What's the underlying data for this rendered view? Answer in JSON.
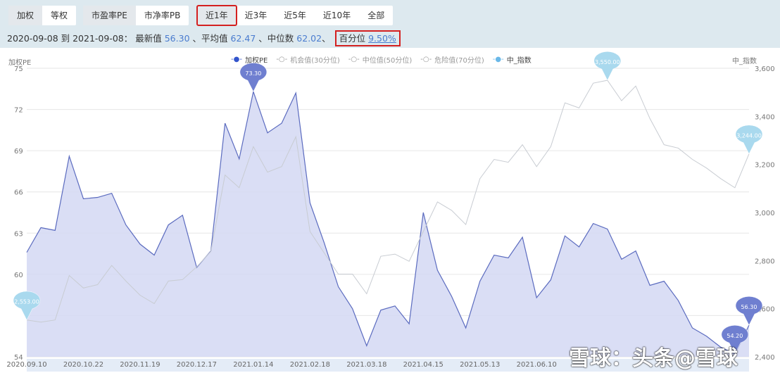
{
  "toolbar": {
    "weight_tabs": [
      "加权",
      "等权"
    ],
    "metric_tabs": [
      "市盈率PE",
      "市净率PB"
    ],
    "range_tabs": [
      "近1年",
      "近3年",
      "近5年",
      "近10年",
      "全部"
    ],
    "selected_range": "近1年"
  },
  "stats": {
    "period": "2020-09-08 到 2021-09-08：",
    "latest_label": "最新值",
    "latest": "56.30",
    "avg_label": "、平均值",
    "avg": "62.47",
    "median_label": "、中位数",
    "median": "62.02",
    "sep": "、",
    "pct_label": "百分位",
    "pct": "9.50%"
  },
  "chart_data": {
    "type": "line",
    "left_axis_title": "加权PE",
    "right_axis_title": "中_指数",
    "legend": [
      "加权PE",
      "机会值(30分位)",
      "中位值(50分位)",
      "危险值(70分位)",
      "中_指数"
    ],
    "ylim_left": [
      54,
      75
    ],
    "yticks_left": [
      54,
      57,
      60,
      63,
      66,
      69,
      72,
      75
    ],
    "yticks_left_labels": [
      "54",
      "",
      "60",
      "63",
      "66",
      "69",
      "72",
      "75"
    ],
    "ylim_right": [
      2400,
      3600
    ],
    "yticks_right": [
      "2,400",
      "2,600",
      "2,800",
      "3,000",
      "3,200",
      "3,400",
      "3,600"
    ],
    "x_labels": [
      "2020.09.10",
      "2020.10.22",
      "2020.11.19",
      "2020.12.17",
      "2021.01.14",
      "2021.02.18",
      "2021.03.18",
      "2021.04.15",
      "2021.05.13",
      "2021.06.10"
    ],
    "x_label_index": [
      0,
      4,
      8,
      12,
      16,
      20,
      24,
      28,
      32,
      36
    ],
    "series": [
      {
        "name": "加权PE",
        "axis": "left",
        "color": "#5b6bbf",
        "values": [
          61.6,
          63.4,
          63.2,
          68.6,
          65.5,
          65.6,
          65.9,
          63.6,
          62.2,
          61.4,
          63.6,
          64.3,
          60.5,
          61.7,
          71.0,
          68.4,
          73.3,
          70.3,
          71.0,
          73.2,
          65.2,
          62.3,
          59.1,
          57.5,
          54.8,
          57.4,
          57.7,
          56.4,
          64.5,
          60.3,
          58.4,
          56.1,
          59.5,
          61.4,
          61.2,
          62.7,
          58.3,
          59.6,
          62.8,
          62.0,
          63.7,
          63.3,
          61.1,
          61.7,
          59.2,
          59.5,
          58.1,
          56.1,
          55.5,
          54.7,
          54.2,
          56.3
        ]
      },
      {
        "name": "中_指数",
        "axis": "right",
        "color": "#c8ccd2",
        "values": [
          2553,
          2544,
          2553,
          2738,
          2686,
          2700,
          2780,
          2715,
          2656,
          2621,
          2715,
          2721,
          2774,
          2838,
          3156,
          3103,
          3274,
          3168,
          3191,
          3315,
          2921,
          2832,
          2744,
          2744,
          2662,
          2818,
          2827,
          2797,
          2921,
          3044,
          3009,
          2950,
          3141,
          3221,
          3209,
          3282,
          3191,
          3274,
          3456,
          3435,
          3538,
          3550,
          3465,
          3526,
          3391,
          3282,
          3268,
          3221,
          3185,
          3141,
          3103,
          3244
        ]
      }
    ],
    "markers": [
      {
        "series": 0,
        "index": 16,
        "label": "73.30",
        "color": "#6f7fd0"
      },
      {
        "series": 0,
        "index": 50,
        "label": "54.20",
        "color": "#6f7fd0"
      },
      {
        "series": 0,
        "index": 51,
        "label": "56.30",
        "color": "#6f7fd0"
      },
      {
        "series": 1,
        "index": 0,
        "label": "2,553.00",
        "color": "#a9d9ee"
      },
      {
        "series": 1,
        "index": 41,
        "label": "3,550.00",
        "color": "#a9d9ee"
      },
      {
        "series": 1,
        "index": 51,
        "label": "3,244.00",
        "color": "#a9d9ee"
      }
    ]
  },
  "watermark": "雪球：头条@雪球"
}
